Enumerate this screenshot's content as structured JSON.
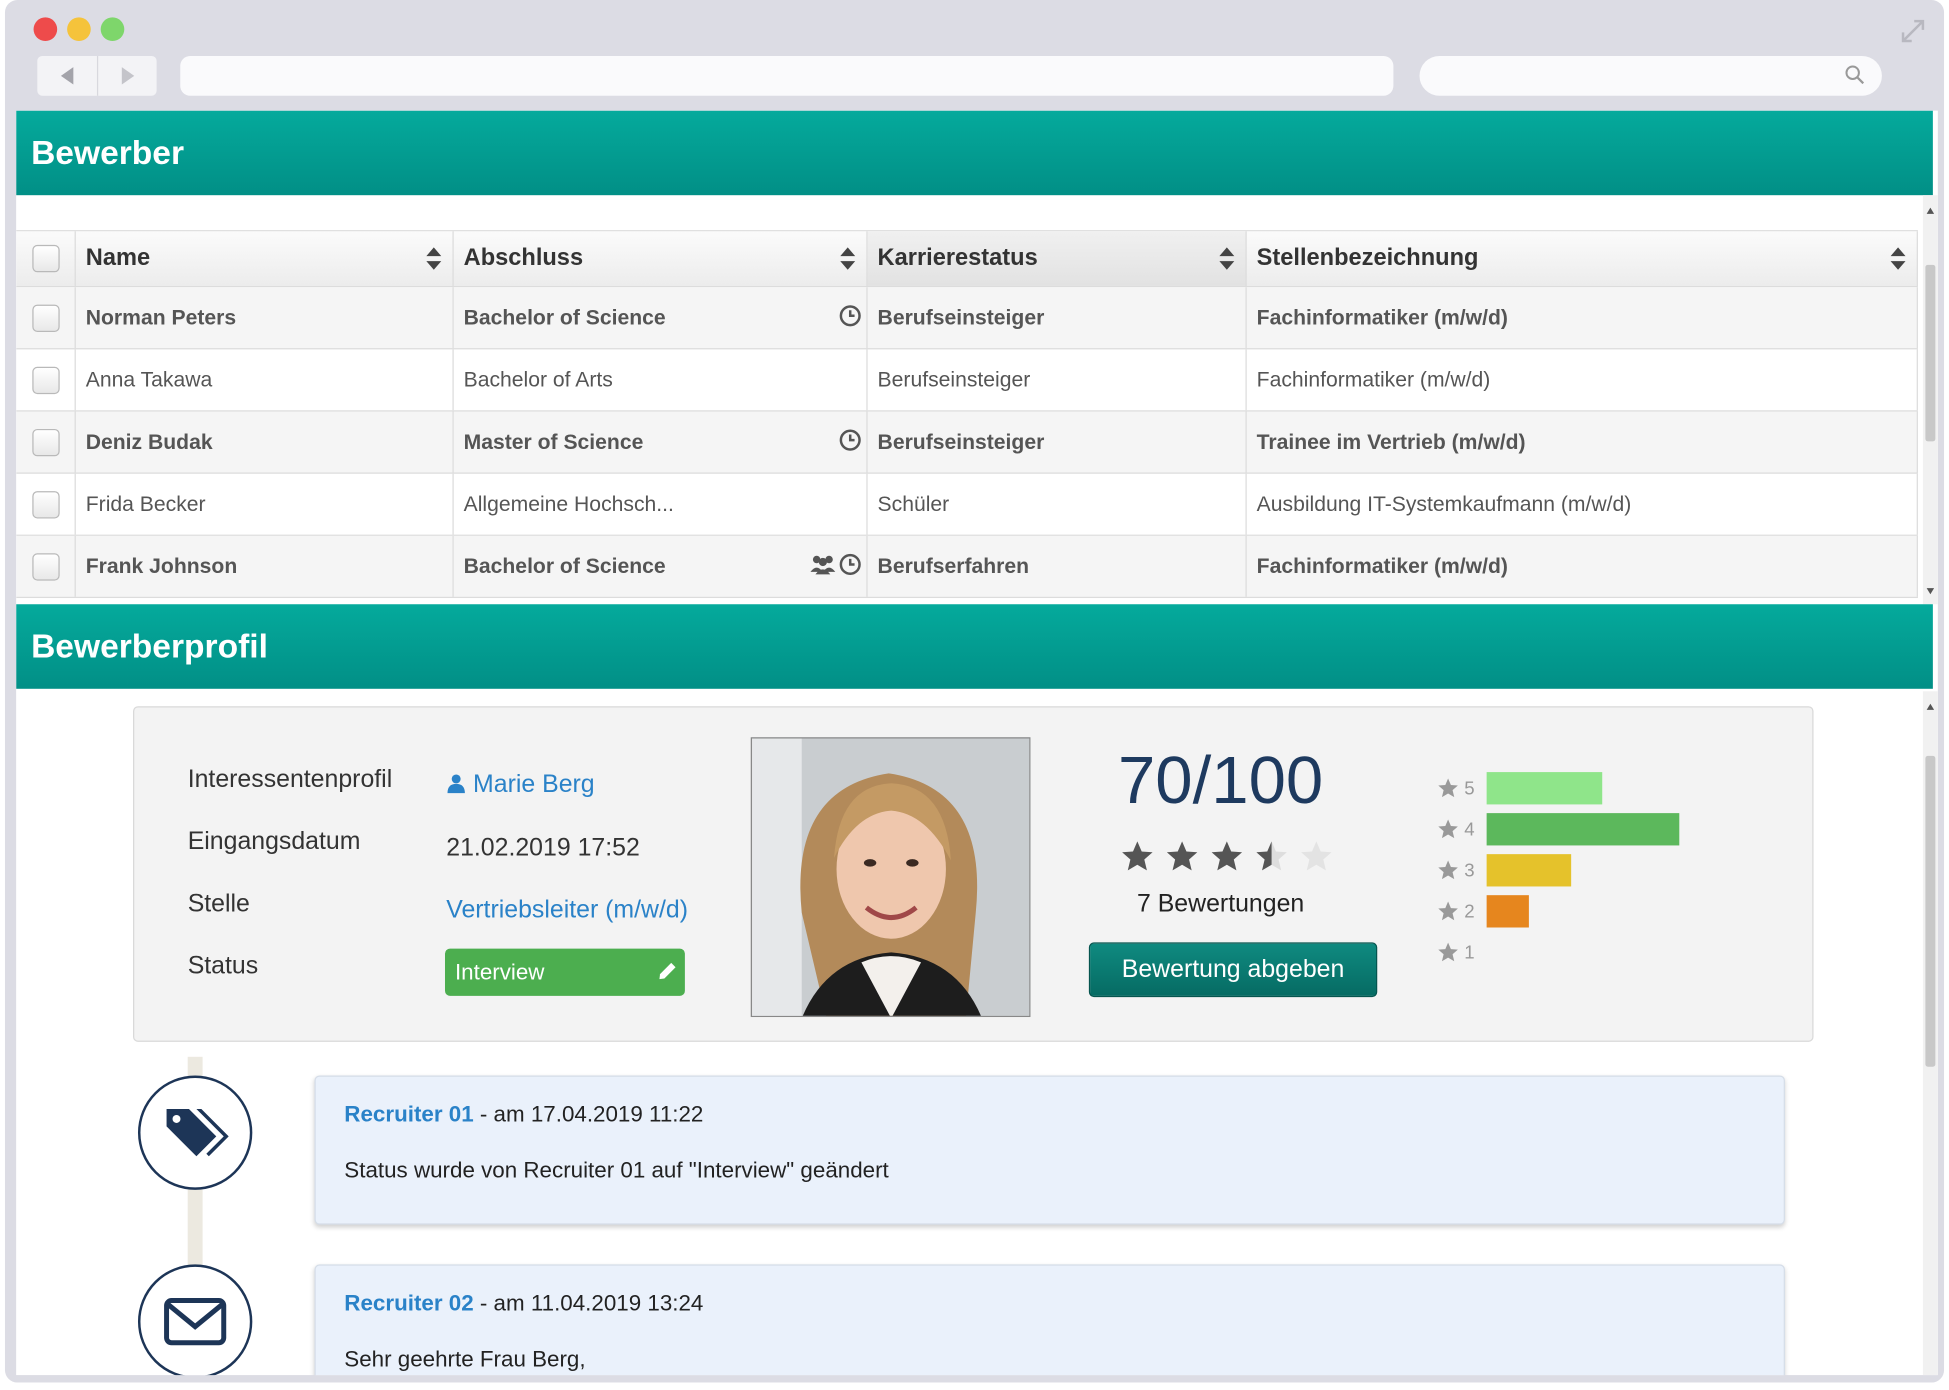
{
  "colors": {
    "accent": "#039e93",
    "link": "#2a82c8",
    "status_green": "#4cae4f",
    "navy": "#1e3a5f"
  },
  "panels": {
    "applicants_title": "Bewerber",
    "profile_title": "Bewerberprofil"
  },
  "table": {
    "columns": [
      "Name",
      "Abschluss",
      "Karrierestatus",
      "Stellenbezeichnung"
    ],
    "rows": [
      {
        "name": "Norman Peters",
        "degree": "Bachelor of Science",
        "career": "Berufseinsteiger",
        "job": "Fachinformatiker (m/w/d)",
        "icons": [
          "clock-icon"
        ]
      },
      {
        "name": "Anna Takawa",
        "degree": "Bachelor of Arts",
        "career": "Berufseinsteiger",
        "job": "Fachinformatiker (m/w/d)",
        "icons": []
      },
      {
        "name": "Deniz Budak",
        "degree": "Master of Science",
        "career": "Berufseinsteiger",
        "job": "Trainee im Vertrieb (m/w/d)",
        "icons": [
          "clock-icon"
        ]
      },
      {
        "name": "Frida Becker",
        "degree": "Allgemeine Hochsch...",
        "career": "Schüler",
        "job": "Ausbildung IT-Systemkaufmann (m/w/d)",
        "icons": []
      },
      {
        "name": "Frank Johnson",
        "degree": "Bachelor of Science",
        "career": "Berufserfahren",
        "job": "Fachinformatiker (m/w/d)",
        "icons": [
          "users-icon",
          "clock-icon"
        ]
      }
    ]
  },
  "profile": {
    "labels": {
      "interest": "Interessentenprofil",
      "date": "Eingangsdatum",
      "position": "Stelle",
      "status": "Status"
    },
    "name": "Marie Berg",
    "date": "21.02.2019 17:52",
    "position": "Vertriebsleiter (m/w/d)",
    "status": "Interview",
    "score": "70/100",
    "stars_rating": 3.5,
    "rating_count": "7 Bewertungen",
    "rate_button": "Bewertung abgeben",
    "distribution": [
      {
        "label": "5",
        "value": 3,
        "color": "#8fe58a"
      },
      {
        "label": "4",
        "value": 5,
        "color": "#5cb85c"
      },
      {
        "label": "3",
        "value": 2.2,
        "color": "#e5c22b"
      },
      {
        "label": "2",
        "value": 1.1,
        "color": "#e6861e"
      },
      {
        "label": "1",
        "value": 0,
        "color": "#cccccc"
      }
    ]
  },
  "timeline": [
    {
      "who": "Recruiter 01",
      "when": " - am 17.04.2019 11:22",
      "text": "Status wurde von Recruiter 01 auf \"Interview\" geändert",
      "icon": "tags-icon"
    },
    {
      "who": "Recruiter 02",
      "when": " - am 11.04.2019 13:24",
      "text": "Sehr geehrte Frau Berg,",
      "icon": "envelope-icon"
    }
  ]
}
